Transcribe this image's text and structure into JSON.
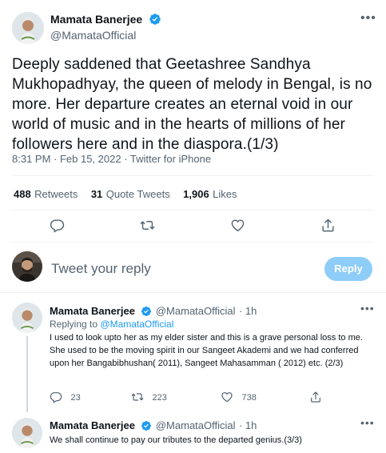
{
  "main_tweet": {
    "author_name": "Mamata Banerjee",
    "author_handle": "@MamataOfficial",
    "text": "Deeply saddened that Geetashree Sandhya Mukhopadhyay, the queen of melody in Bengal, is no more. Her departure creates an eternal void in our world of music and in the hearts of millions of her followers here and in the diaspora.(1/3)",
    "timestamp": "8:31 PM · Feb 15, 2022 · Twitter for iPhone",
    "retweets_count": "488",
    "retweets_label": "Retweets",
    "quote_count": "31",
    "quote_label": "Quote Tweets",
    "likes_count": "1,906",
    "likes_label": "Likes"
  },
  "reply_box": {
    "placeholder": "Tweet your reply",
    "button_label": "Reply"
  },
  "thread": [
    {
      "author_name": "Mamata Banerjee",
      "author_handle": "@MamataOfficial",
      "time": "· 1h",
      "replying_prefix": "Replying to",
      "replying_to": "@MamataOfficial",
      "text": "I used to look upto her as my elder sister and this is a grave personal loss to me. She used to be the moving spirit in our Sangeet Akademi and we had conferred upon her Bangabibhushan( 2011), Sangeet Mahasamman ( 2012) etc. (2/3)",
      "replies": "23",
      "retweets": "223",
      "likes": "738"
    },
    {
      "author_name": "Mamata Banerjee",
      "author_handle": "@MamataOfficial",
      "time": "· 1h",
      "text": "We shall continue to pay our tributes to the departed genius.(3/3)"
    }
  ],
  "colors": {
    "accent": "#1d9bf0",
    "text_primary": "#0f1419",
    "text_secondary": "#536471",
    "reply_button_bg": "#8ecdf8",
    "divider": "#eff3f4"
  },
  "icons": [
    "verified-badge-icon",
    "more-options-icon",
    "reply-icon",
    "retweet-icon",
    "like-icon",
    "share-icon"
  ]
}
